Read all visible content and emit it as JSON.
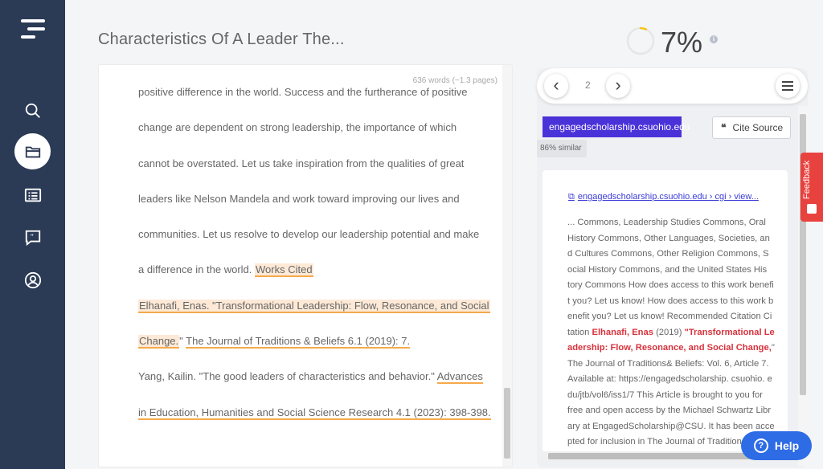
{
  "sidebar": {
    "items": [
      {
        "icon": "search-icon"
      },
      {
        "icon": "folder-icon",
        "active": true
      },
      {
        "icon": "list-icon"
      },
      {
        "icon": "quote-icon"
      },
      {
        "icon": "user-icon"
      }
    ]
  },
  "document": {
    "title": "Characteristics Of A Leader The...",
    "word_count": "636 words (~1.3 pages)",
    "lines": [
      "positive difference in the world. Success and the furtherance of positive",
      "change are dependent on strong leadership, the importance of which",
      "cannot be overstated. Let us take inspiration from the qualities of great",
      "leaders like Nelson Mandela and work toward improving our lives and",
      "communities. Let us resolve to develop our leadership potential and make"
    ],
    "line6_pre": "a difference in the world. ",
    "line6_hl": "Works Cited",
    "line7_hl": "Elhanafi, Enas. \"Transformational Leadership: Flow, Resonance, and Social",
    "line8_hl": "Change.",
    "line8_mid": "\" ",
    "line8_ul": "The Journal of Traditions & Beliefs 6.1 (2019): 7.",
    "line9_pre": "Yang, Kailin. \"The good leaders of characteristics and behavior.\" ",
    "line9_ul": "Advances",
    "line10_ul": "in Education, Humanities and Social Science Research 4.1 (2023): 398-398."
  },
  "score": {
    "value": "7%",
    "fraction": 0.07,
    "ring_color": "#f5c518",
    "info": "i"
  },
  "pager": {
    "prev": "‹",
    "page": "2",
    "next": "›"
  },
  "source": {
    "domain": "engagedscholarship.csuohio.edu",
    "similarity": "86% similar",
    "cite_label": "Cite Source",
    "cite_quote": "❝",
    "link_text": "engagedscholarship.csuohio.edu › cgi › view...",
    "body_lines": [
      "... Commons, Leadership Studies Commons, Oral",
      "History Commons, Other Languages, Societies, an",
      "d Cultures Commons, Other Religion Commons, S",
      "ocial History Commons, and the United States His",
      "tory Commons How does access to this work benefi",
      "t you? Let us know! How does access to this work b",
      "enefit you? Let us know! Recommended Citation Ci"
    ],
    "line8_pre": "tation ",
    "line8_m1": "Elhanafi, Enas",
    "line8_mid": " (2019) ",
    "line8_m2": "\"Transformational Le",
    "line9_m": "adership: Flow, Resonance, and Social Change,",
    "line9_post": "\"",
    "tail_lines": [
      "The Journal of Traditions& Beliefs: Vol. 6, Article 7.",
      "Available at: https://engagedscholarship. csuohio. e",
      "du/jtb/vol6/iss1/7 This Article is brought to you for",
      "free and open access by the Michael Schwartz Libr",
      "ary at EngagedScholarship@CSU. It has been acce",
      "pted for inclusion in The Journal of Traditions"
    ]
  },
  "feedback_label": "Feedback",
  "help_label": "Help",
  "help_q": "?",
  "colors": {
    "sidebar": "#2b3a55",
    "accent": "#4a32d9",
    "highlight": "#f5a94b",
    "match": "#d8323c",
    "help": "#2e6ce6",
    "feedback": "#e8423f"
  }
}
